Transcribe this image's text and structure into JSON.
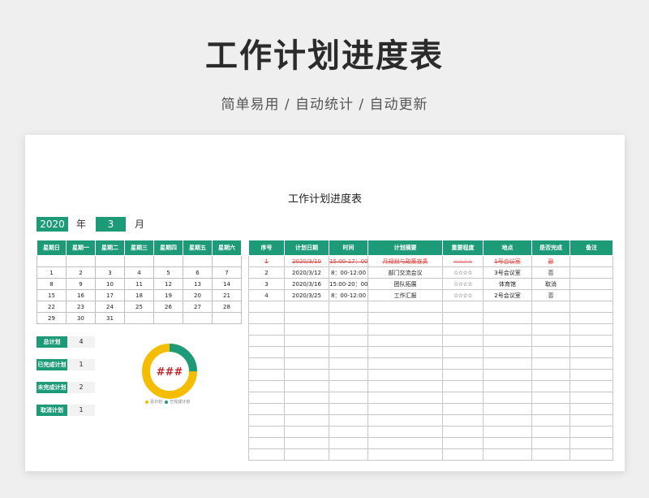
{
  "hero": {
    "title": "工作计划进度表",
    "subtitle": "简单易用 / 自动统计 / 自动更新"
  },
  "sheet": {
    "title": "工作计划进度表",
    "year": "2020",
    "year_label": "年",
    "month": "3",
    "month_label": "月"
  },
  "calendar": {
    "headers": [
      "星期日",
      "星期一",
      "星期二",
      "星期三",
      "星期四",
      "星期五",
      "星期六"
    ],
    "weeks": [
      [
        "",
        "",
        "",
        "",
        "",
        "",
        ""
      ],
      [
        "1",
        "2",
        "3",
        "4",
        "5",
        "6",
        "7"
      ],
      [
        "8",
        "9",
        "10",
        "11",
        "12",
        "13",
        "14"
      ],
      [
        "15",
        "16",
        "17",
        "18",
        "19",
        "20",
        "21"
      ],
      [
        "22",
        "23",
        "24",
        "25",
        "26",
        "27",
        "28"
      ],
      [
        "29",
        "30",
        "31",
        "",
        "",
        "",
        ""
      ]
    ]
  },
  "plan": {
    "headers": [
      "序号",
      "计划日期",
      "时间",
      "计划摘要",
      "重要程度",
      "地点",
      "是否完成",
      "备注"
    ],
    "rows": [
      {
        "done": true,
        "cells": [
          "1",
          "2020/3/10",
          "15:00-17：00",
          "月规划与政策宣贯",
          "☆☆☆☆",
          "1号会议室",
          "是",
          ""
        ]
      },
      {
        "done": false,
        "cells": [
          "2",
          "2020/3/12",
          "8：00-12:00",
          "部门交流会议",
          "☆☆☆☆",
          "3号会议室",
          "否",
          ""
        ]
      },
      {
        "done": false,
        "cells": [
          "3",
          "2020/3/16",
          "15:00-20：00",
          "团队拓展",
          "☆☆☆☆",
          "体育馆",
          "取消",
          ""
        ]
      },
      {
        "done": false,
        "cells": [
          "4",
          "2020/3/25",
          "8：00-12:00",
          "工作汇报",
          "☆☆☆☆",
          "2号会议室",
          "否",
          ""
        ]
      }
    ],
    "empty_rows": 14
  },
  "stats": [
    {
      "label": "总计划",
      "value": "4"
    },
    {
      "label": "已完成计划",
      "value": "1"
    },
    {
      "label": "未完成计划",
      "value": "2"
    },
    {
      "label": "取消计划",
      "value": "1"
    }
  ],
  "donut": {
    "center_text": "###",
    "legend": [
      "总计划",
      "已完成计划"
    ],
    "completed_fraction": 0.25
  },
  "colors": {
    "accent": "#1d9a78",
    "donut_total": "#f5bd00",
    "donut_done": "#1d9a78",
    "done_text": "#e04848",
    "stars": "#ef8f8f"
  }
}
